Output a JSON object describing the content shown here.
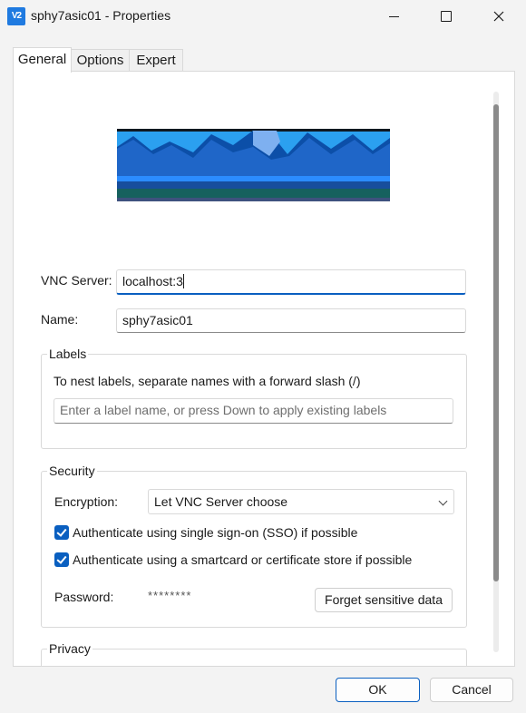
{
  "window": {
    "title": "sphy7asic01 - Properties",
    "app_icon_text": "V2"
  },
  "tabs": [
    "General",
    "Options",
    "Expert"
  ],
  "general": {
    "vnc_server_label": "VNC Server:",
    "vnc_server_value": "localhost:3",
    "name_label": "Name:",
    "name_value": "sphy7asic01",
    "labels": {
      "title": "Labels",
      "hint": "To nest labels, separate names with a forward slash (/)",
      "input_placeholder": "Enter a label name, or press Down to apply existing labels"
    },
    "security": {
      "title": "Security",
      "encryption_label": "Encryption:",
      "encryption_value": "Let VNC Server choose",
      "sso_checkbox": {
        "label": "Authenticate using single sign-on (SSO) if possible",
        "checked": true
      },
      "smartcard_checkbox": {
        "label": "Authenticate using a smartcard or certificate store if possible",
        "checked": true
      },
      "password_label": "Password:",
      "password_value": "********",
      "forget_button": "Forget sensitive data"
    },
    "privacy": {
      "title": "Privacy"
    }
  },
  "footer": {
    "ok": "OK",
    "cancel": "Cancel"
  },
  "colors": {
    "accent": "#0a5fc0",
    "window_bg": "#f3f3f3",
    "panel_bg": "#ffffff"
  }
}
